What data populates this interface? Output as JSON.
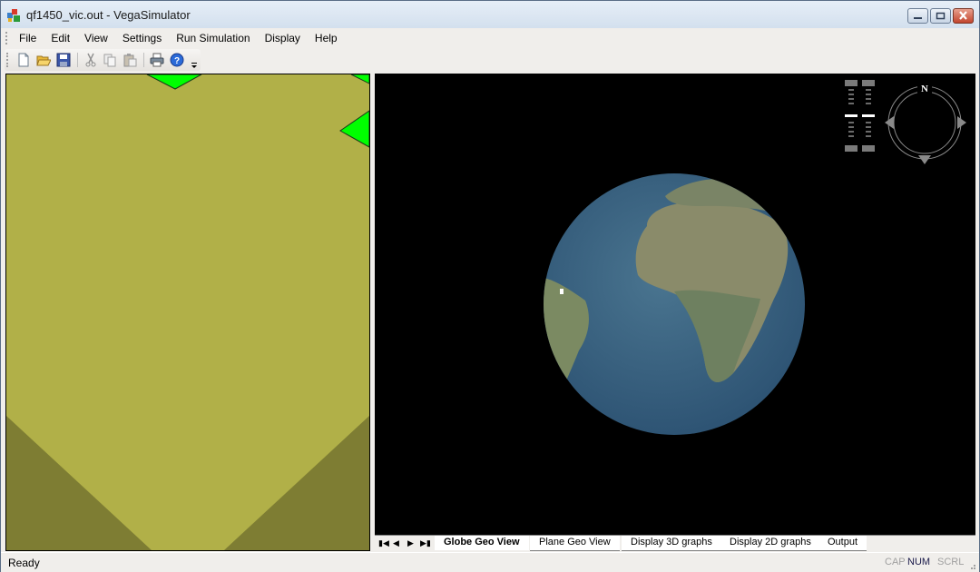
{
  "window": {
    "title": "qf1450_vic.out - VegaSimulator",
    "app_icon": "vega-app-icon",
    "controls": [
      "minimize",
      "maximize",
      "close"
    ]
  },
  "menubar": {
    "items": [
      "File",
      "Edit",
      "View",
      "Settings",
      "Run Simulation",
      "Display",
      "Help"
    ]
  },
  "toolbar": {
    "buttons": [
      {
        "name": "new-icon",
        "label": "New"
      },
      {
        "name": "open-icon",
        "label": "Open"
      },
      {
        "name": "save-icon",
        "label": "Save"
      },
      {
        "name": "cut-icon",
        "label": "Cut"
      },
      {
        "name": "copy-icon",
        "label": "Copy"
      },
      {
        "name": "paste-icon",
        "label": "Paste"
      },
      {
        "name": "print-icon",
        "label": "Print"
      },
      {
        "name": "help-icon",
        "label": "About"
      }
    ]
  },
  "left_view": {
    "background_color": "#b1b048",
    "shadow_color": "#7e7d33",
    "marker_color": "#00ff00"
  },
  "globe_view": {
    "compass_label": "N",
    "zoom_slider_level": 0.5,
    "tilt_slider_level": 0.5
  },
  "tabs": {
    "items": [
      "Globe Geo View",
      "Plane Geo View",
      "Display 3D graphs",
      "Display 2D graphs",
      "Output"
    ],
    "active": "Globe Geo View"
  },
  "statusbar": {
    "text": "Ready",
    "indicators": [
      {
        "label": "CAP",
        "active": false
      },
      {
        "label": "NUM",
        "active": true
      },
      {
        "label": "SCRL",
        "active": false
      }
    ]
  }
}
